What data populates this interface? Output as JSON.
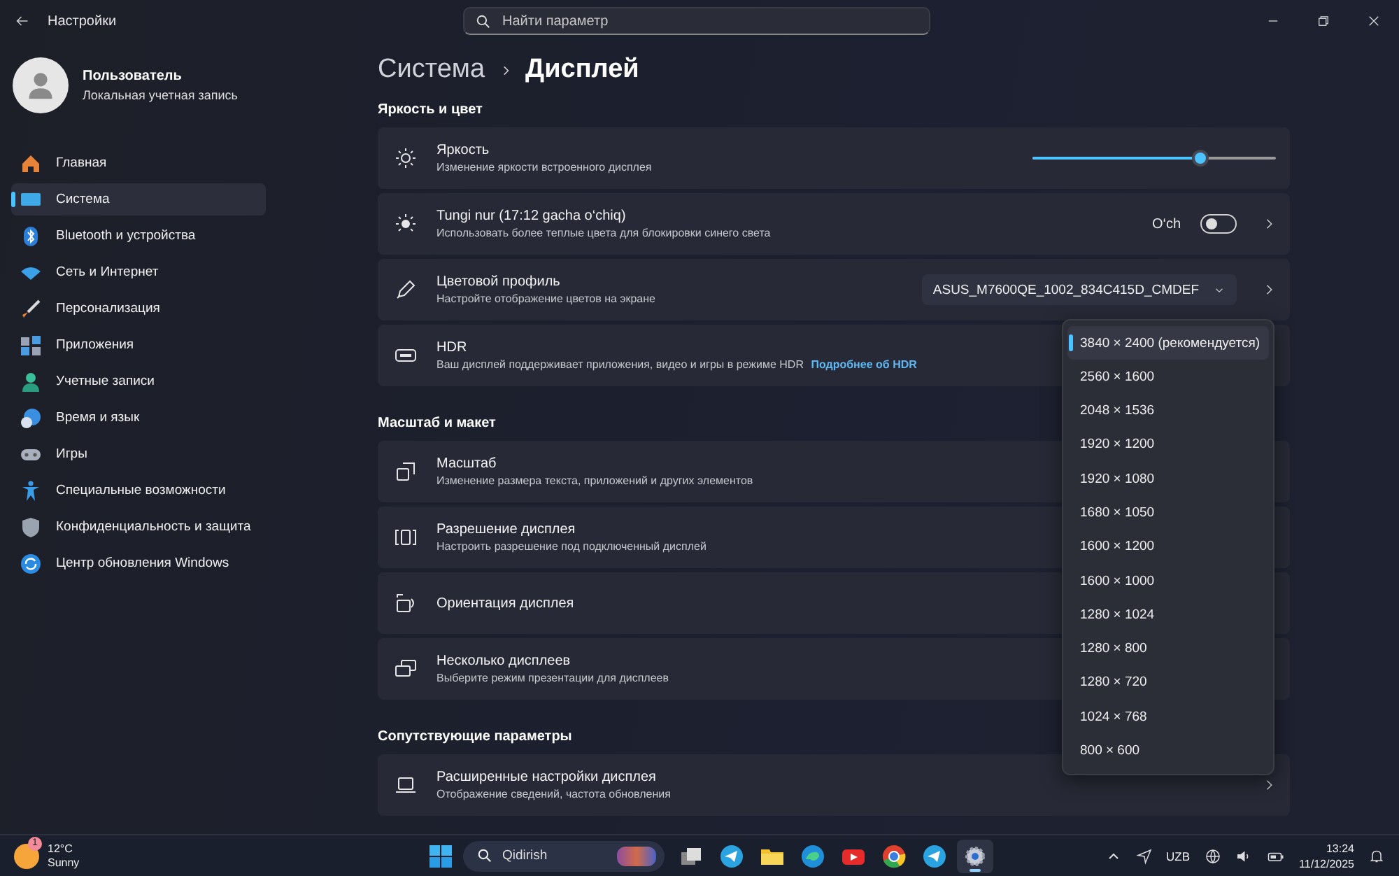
{
  "window": {
    "title": "Настройки",
    "search_placeholder": "Найти параметр"
  },
  "user": {
    "name": "Пользователь",
    "account": "Локальная учетная запись"
  },
  "sidebar": {
    "items": [
      {
        "label": "Главная",
        "selected": false
      },
      {
        "label": "Система",
        "selected": true
      },
      {
        "label": "Bluetooth и устройства",
        "selected": false
      },
      {
        "label": "Сеть и Интернет",
        "selected": false
      },
      {
        "label": "Персонализация",
        "selected": false
      },
      {
        "label": "Приложения",
        "selected": false
      },
      {
        "label": "Учетные записи",
        "selected": false
      },
      {
        "label": "Время и язык",
        "selected": false
      },
      {
        "label": "Игры",
        "selected": false
      },
      {
        "label": "Специальные возможности",
        "selected": false
      },
      {
        "label": "Конфиденциальность и защита",
        "selected": false
      },
      {
        "label": "Центр обновления Windows",
        "selected": false
      }
    ]
  },
  "breadcrumb": {
    "parent": "Система",
    "current": "Дисплей"
  },
  "sections": [
    {
      "title": "Яркость и цвет",
      "rows": [
        {
          "kind": "slider",
          "title": "Яркость",
          "subtitle": "Изменение яркости встроенного дисплея",
          "level": 0.69,
          "chevron": false
        },
        {
          "kind": "toggle",
          "title": "Tungi nur (17:12 gacha o‘chiq)",
          "subtitle": "Использовать более теплые цвета для блокировки синего света",
          "state_label": "O‘ch",
          "on": false,
          "chevron": true
        },
        {
          "kind": "dropdown",
          "title": "Цветовой профиль",
          "subtitle": "Настройте отображение цветов на экране",
          "value": "ASUS_M7600QE_1002_834C415D_CMDEF",
          "chevron": true
        },
        {
          "kind": "plain",
          "title": "HDR",
          "subtitle": "Ваш дисплей поддерживает приложения, видео и игры в режиме HDR",
          "link": "Подробнее об HDR",
          "chevron": false
        }
      ]
    },
    {
      "title": "Масштаб и макет",
      "rows": [
        {
          "kind": "plain",
          "title": "Масштаб",
          "subtitle": "Изменение размера текста, приложений и других элементов",
          "chevron": false
        },
        {
          "kind": "plain",
          "title": "Разрешение дисплея",
          "subtitle": "Настроить разрешение под подключенный дисплей",
          "chevron": false
        },
        {
          "kind": "plain",
          "title": "Ориентация дисплея",
          "chevron": false
        },
        {
          "kind": "plain",
          "title": "Несколько дисплеев",
          "subtitle": "Выберите режим презентации для дисплеев",
          "chevron": false
        }
      ]
    },
    {
      "title": "Сопутствующие параметры",
      "rows": [
        {
          "kind": "plain",
          "title": "Расширенные настройки дисплея",
          "subtitle": "Отображение сведений, частота обновления",
          "chevron": true
        }
      ]
    }
  ],
  "resolution_menu": {
    "options": [
      {
        "label": "3840 × 2400 (рекомендуется)",
        "selected": true
      },
      {
        "label": "2560 × 1600",
        "selected": false
      },
      {
        "label": "2048 × 1536",
        "selected": false
      },
      {
        "label": "1920 × 1200",
        "selected": false
      },
      {
        "label": "1920 × 1080",
        "selected": false
      },
      {
        "label": "1680 × 1050",
        "selected": false
      },
      {
        "label": "1600 × 1200",
        "selected": false
      },
      {
        "label": "1600 × 1000",
        "selected": false
      },
      {
        "label": "1280 × 1024",
        "selected": false
      },
      {
        "label": "1280 × 800",
        "selected": false
      },
      {
        "label": "1280 × 720",
        "selected": false
      },
      {
        "label": "1024 × 768",
        "selected": false
      },
      {
        "label": "800 × 600",
        "selected": false
      }
    ]
  },
  "taskbar": {
    "weather": {
      "badge": "1",
      "temperature": "12°C",
      "condition": "Sunny"
    },
    "search_placeholder": "Qidirish",
    "apps": [
      {
        "selected": false
      },
      {
        "selected": false
      },
      {
        "selected": false
      },
      {
        "selected": false
      },
      {
        "selected": false
      },
      {
        "selected": false
      },
      {
        "selected": true
      }
    ],
    "language": "UZB",
    "time": "13:24",
    "date": "11/12/2025"
  }
}
